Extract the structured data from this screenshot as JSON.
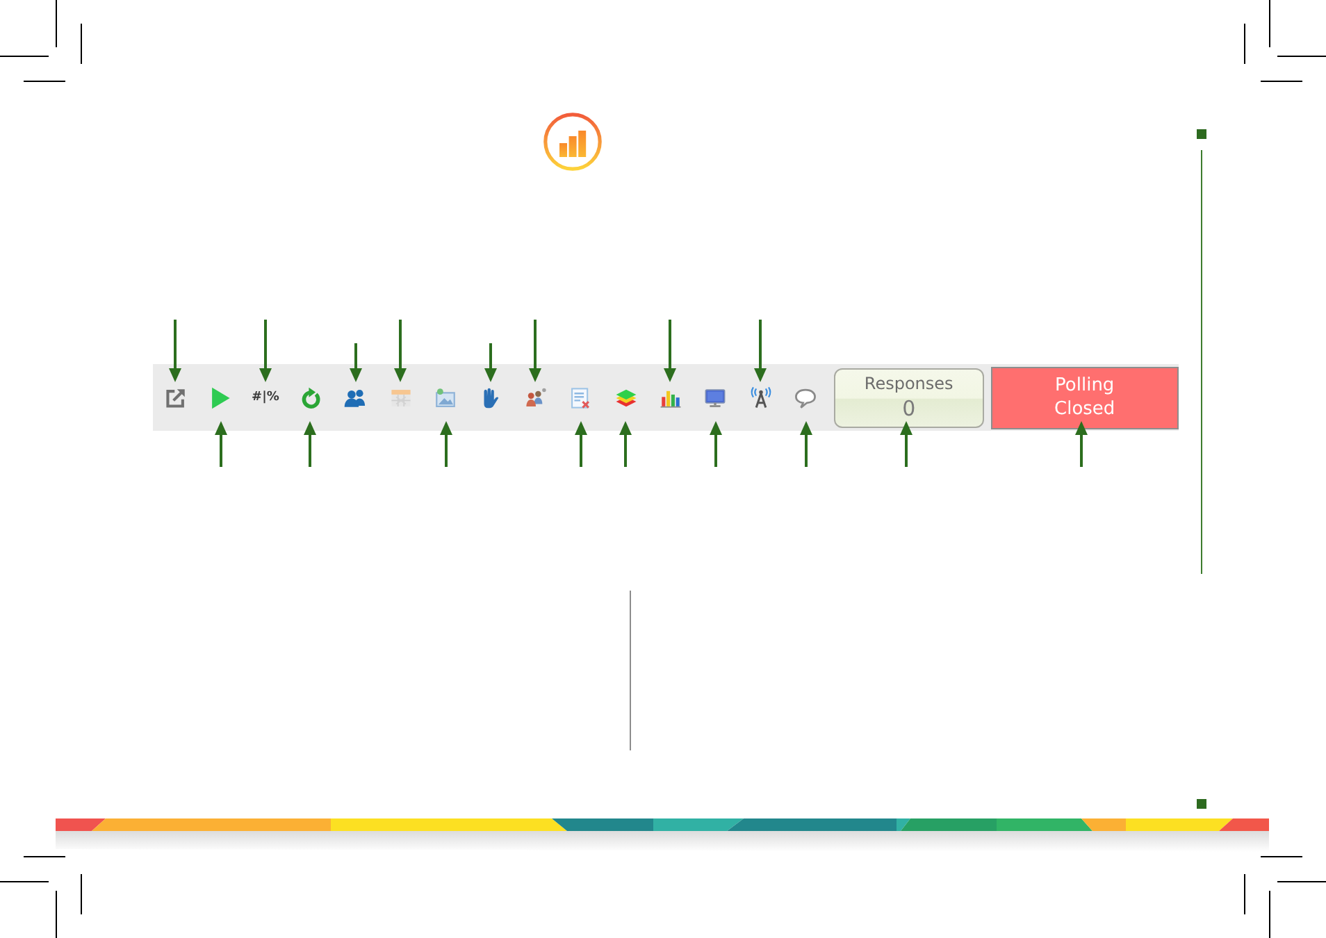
{
  "toolbar": {
    "items": [
      {
        "kind": "export",
        "arrow_above": true,
        "arrow_short": false
      },
      {
        "kind": "play",
        "arrow_above": false,
        "arrow_short": false
      },
      {
        "kind": "format",
        "label": "#|%",
        "arrow_above": true,
        "arrow_short": false
      },
      {
        "kind": "refresh",
        "arrow_above": false,
        "arrow_short": false
      },
      {
        "kind": "participants",
        "arrow_above": true,
        "arrow_short": true
      },
      {
        "kind": "table",
        "arrow_above": true,
        "arrow_short": false
      },
      {
        "kind": "picture",
        "arrow_above": false,
        "arrow_short": false
      },
      {
        "kind": "hand",
        "arrow_above": true,
        "arrow_short": true
      },
      {
        "kind": "group",
        "arrow_above": true,
        "arrow_short": false
      },
      {
        "kind": "clear-list",
        "arrow_above": false,
        "arrow_short": false
      },
      {
        "kind": "layers",
        "arrow_above": false,
        "arrow_short": false
      },
      {
        "kind": "chart",
        "arrow_above": true,
        "arrow_short": false
      },
      {
        "kind": "monitor",
        "arrow_above": false,
        "arrow_short": false
      },
      {
        "kind": "antenna",
        "arrow_above": true,
        "arrow_short": false
      },
      {
        "kind": "speech",
        "arrow_above": false,
        "arrow_short": false
      }
    ],
    "responses": {
      "label": "Responses",
      "count": "0",
      "arrow_above": false,
      "arrow_short": false
    },
    "polling": {
      "lines": [
        "Polling",
        "Closed"
      ],
      "arrow_above": false,
      "arrow_short": false
    }
  }
}
